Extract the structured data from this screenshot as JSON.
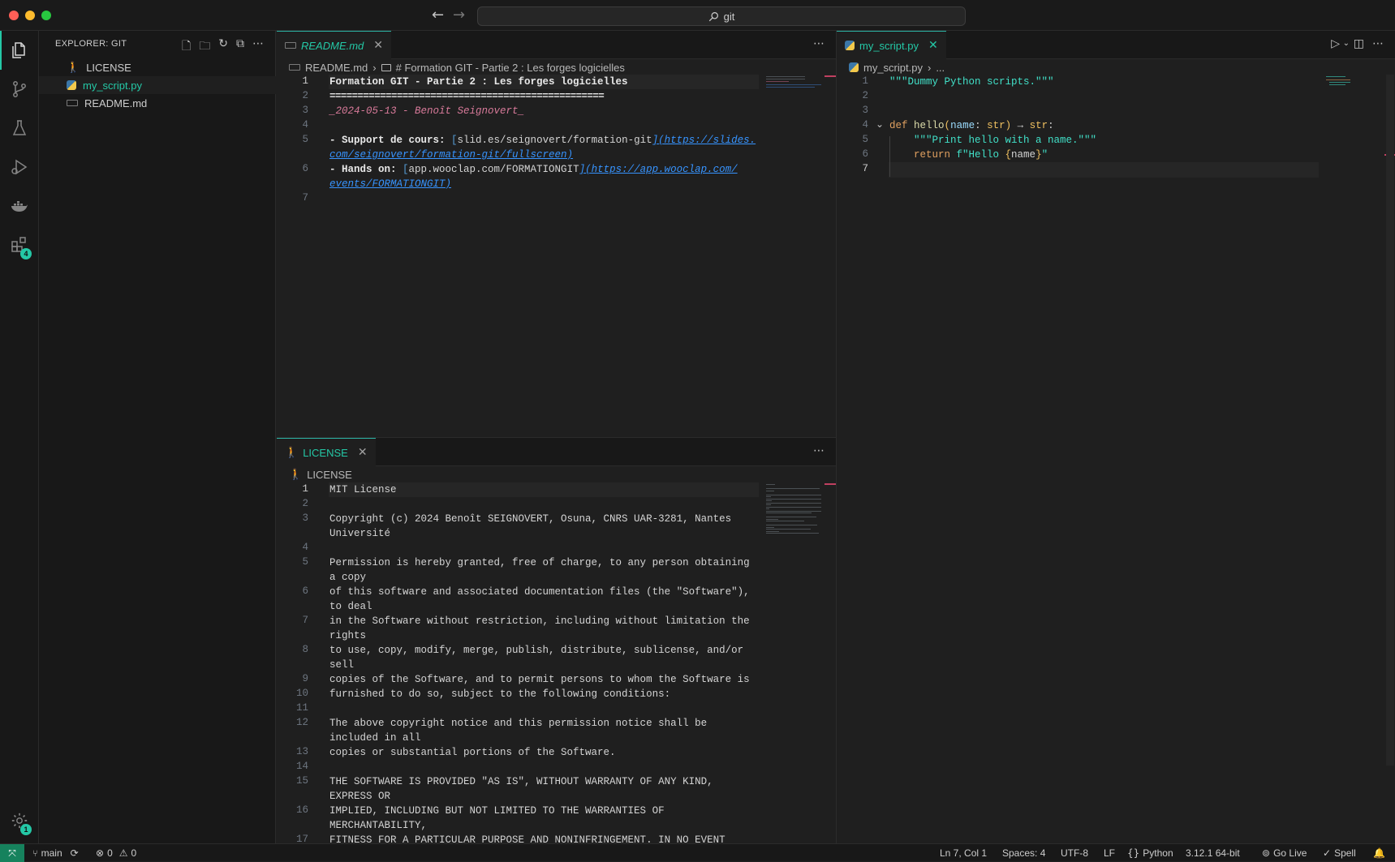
{
  "window": {
    "search_text": "git",
    "search_icon": "search-icon"
  },
  "activity": {
    "items": [
      "files-icon",
      "source-control-icon",
      "testing-icon",
      "run-debug-icon",
      "docker-icon",
      "extensions-icon"
    ],
    "extensions_badge": "4",
    "settings_badge": "1"
  },
  "sidebar": {
    "title": "EXPLORER: GIT",
    "files": [
      {
        "name": "LICENSE",
        "icon": "license-icon"
      },
      {
        "name": "my_script.py",
        "icon": "python-icon"
      },
      {
        "name": "README.md",
        "icon": "markdown-icon"
      }
    ]
  },
  "readme": {
    "tab_label": "README.md",
    "breadcrumb_file": "README.md",
    "breadcrumb_symbol": "# Formation GIT - Partie 2 : Les forges logicielles",
    "lines": {
      "l1": "Formation GIT - Partie 2 : Les forges logicielles",
      "l2": "=================================================",
      "l3": "_2024-05-13 - Benoît Seignovert_",
      "l5a": "- Support de cours: ",
      "l5b": "[",
      "l5c": "slid.es/seignovert/formation-git",
      "l5d": "](https://slides.",
      "l5e": "com/seignovert/formation-git/fullscreen)",
      "l6a": "- Hands on: ",
      "l6b": "[",
      "l6c": "app.wooclap.com/FORMATIONGIT",
      "l6d": "](https://app.wooclap.com/",
      "l6e": "events/FORMATIONGIT)"
    },
    "numbers": [
      "1",
      "2",
      "3",
      "4",
      "5",
      "6",
      "7"
    ]
  },
  "license": {
    "tab_label": "LICENSE",
    "breadcrumb_file": "LICENSE",
    "numbers": [
      "1",
      "2",
      "3",
      "4",
      "5",
      "6",
      "7",
      "8",
      "9",
      "10",
      "11",
      "12",
      "13",
      "14",
      "15",
      "16",
      "17"
    ],
    "lines": [
      "MIT License",
      "",
      "Copyright (c) 2024 Benoît SEIGNOVERT, Osuna, CNRS UAR-3281, Nantes",
      "Université",
      "",
      "Permission is hereby granted, free of charge, to any person obtaining",
      "a copy",
      "of this software and associated documentation files (the \"Software\"),",
      "to deal",
      "in the Software without restriction, including without limitation the",
      "rights",
      "to use, copy, modify, merge, publish, distribute, sublicense, and/or",
      "sell",
      "copies of the Software, and to permit persons to whom the Software is",
      "furnished to do so, subject to the following conditions:",
      "",
      "The above copyright notice and this permission notice shall be",
      "included in all",
      "copies or substantial portions of the Software.",
      "",
      "THE SOFTWARE IS PROVIDED \"AS IS\", WITHOUT WARRANTY OF ANY KIND,",
      "EXPRESS OR",
      "IMPLIED, INCLUDING BUT NOT LIMITED TO THE WARRANTIES OF",
      "MERCHANTABILITY,",
      "FITNESS FOR A PARTICULAR PURPOSE AND NONINFRINGEMENT. IN NO EVENT"
    ]
  },
  "script": {
    "tab_label": "my_script.py",
    "breadcrumb_file": "my_script.py",
    "breadcrumb_more": "...",
    "numbers": [
      "1",
      "2",
      "3",
      "4",
      "5",
      "6",
      "7"
    ],
    "code": {
      "l1": "\"\"\"Dummy Python scripts.\"\"\"",
      "def": "def",
      "fname": "hello",
      "p_open": "(",
      "param": "name",
      "colon": ": ",
      "ptype": "str",
      "p_close": ")",
      "arrow": " → ",
      "rtype": "str",
      "end": ":",
      "doc": "\"\"\"Print hello with a name.\"\"\"",
      "ret": "return",
      "fpre": " f\"Hello ",
      "brace_o": "{",
      "var": "name",
      "brace_c": "}",
      "fpost": "\""
    }
  },
  "status": {
    "branch": "main",
    "errors": "0",
    "warnings": "0",
    "position": "Ln 7, Col 1",
    "spaces": "Spaces: 4",
    "encoding": "UTF-8",
    "eol": "LF",
    "language": "Python",
    "interpreter": "3.12.1 64-bit",
    "golive": "Go Live",
    "spell": "Spell"
  },
  "colors": {
    "accent": "#24c8a6",
    "remote": "#16825d",
    "background": "#1f1f1f"
  }
}
